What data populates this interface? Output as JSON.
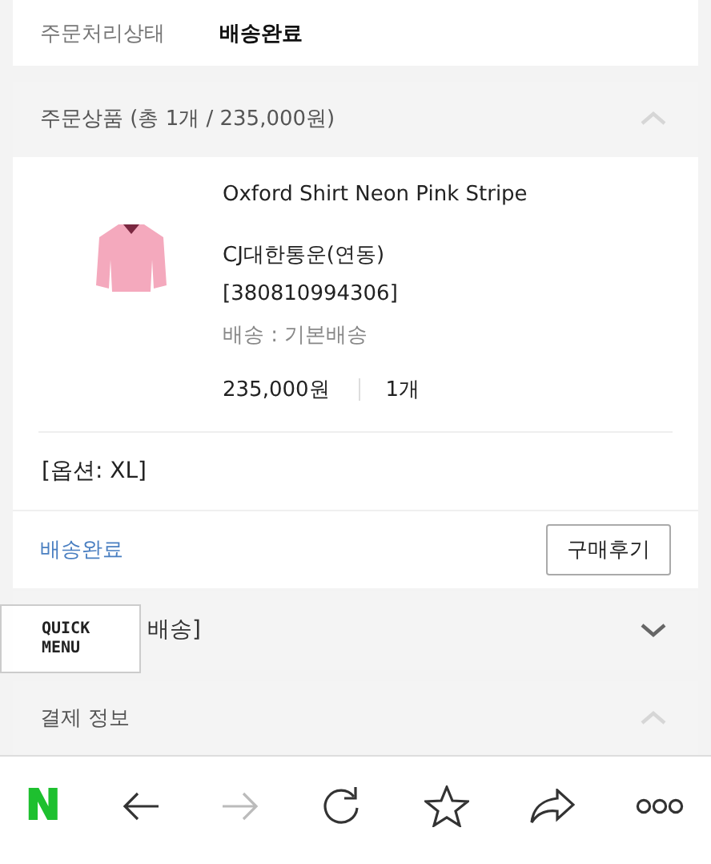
{
  "status_row": {
    "label": "주문처리상태",
    "value": "배송완료"
  },
  "order_items": {
    "header": "주문상품 (총 1개 / 235,000원)",
    "expanded": true,
    "product": {
      "name": "Oxford Shirt Neon Pink Stripe",
      "carrier": "CJ대한통운(연동)",
      "tracking": "[380810994306]",
      "shipping": "배송 : 기본배송",
      "price": "235,000원",
      "quantity": "1개"
    },
    "option": "[옵션: XL]",
    "delivery_status": "배송완료",
    "review_button": "구매후기"
  },
  "shipping_row": {
    "label": "배송]",
    "expanded": false
  },
  "quick_menu": {
    "label": "QUICK MENU"
  },
  "payment": {
    "header": "결제 정보",
    "expanded": true
  },
  "toolbar": [
    {
      "kind": "logo",
      "label": "N"
    },
    {
      "kind": "back",
      "disabled": false
    },
    {
      "kind": "forward",
      "disabled": true
    },
    {
      "kind": "reload",
      "disabled": false
    },
    {
      "kind": "bookmark",
      "disabled": false
    },
    {
      "kind": "share",
      "disabled": false
    },
    {
      "kind": "more",
      "disabled": false
    }
  ]
}
